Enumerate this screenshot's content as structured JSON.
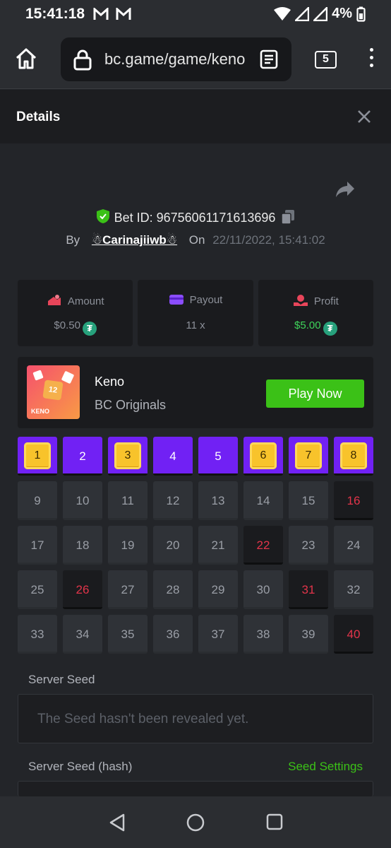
{
  "status": {
    "time": "15:41:18",
    "battery": "4%"
  },
  "browser": {
    "url": "bc.game/game/keno",
    "tab_count": "5"
  },
  "details": {
    "title": "Details"
  },
  "bet": {
    "id_label": "Bet ID: 96756061171613696",
    "by_label": "By",
    "user": "☃Carinajiiwb☃",
    "on_label": "On",
    "date": "22/11/2022, 15:41:02"
  },
  "stats": [
    {
      "label": "Amount",
      "value": "$0.50",
      "icon": "amount-icon",
      "color": "#e8455a"
    },
    {
      "label": "Payout",
      "value": "11 x",
      "icon": "payout-icon",
      "color": "#8b4dff"
    },
    {
      "label": "Profit",
      "value": "$5.00",
      "icon": "profit-icon",
      "color": "#e8455a"
    }
  ],
  "game": {
    "name": "Keno",
    "provider": "BC Originals",
    "play_label": "Play Now",
    "thumb_number": "12",
    "thumb_tag": "KENO"
  },
  "grid": {
    "numbers": [
      1,
      2,
      3,
      4,
      5,
      6,
      7,
      8,
      9,
      10,
      11,
      12,
      13,
      14,
      15,
      16,
      17,
      18,
      19,
      20,
      21,
      22,
      23,
      24,
      25,
      26,
      27,
      28,
      29,
      30,
      31,
      32,
      33,
      34,
      35,
      36,
      37,
      38,
      39,
      40
    ],
    "hits": [
      1,
      3,
      6,
      7,
      8
    ],
    "picked": [
      2,
      4,
      5
    ],
    "misses": [
      16,
      22,
      26,
      31,
      40
    ]
  },
  "seeds": {
    "server_seed_label": "Server Seed",
    "server_seed_placeholder": "The Seed hasn't been revealed yet.",
    "server_seed_hash_label": "Server Seed (hash)",
    "seed_settings_label": "Seed Settings"
  },
  "colors": {
    "accent_green": "#3bc117",
    "picked_purple": "#7121f4",
    "miss_red": "#e2344a",
    "gem_yellow": "#f8c32b"
  }
}
